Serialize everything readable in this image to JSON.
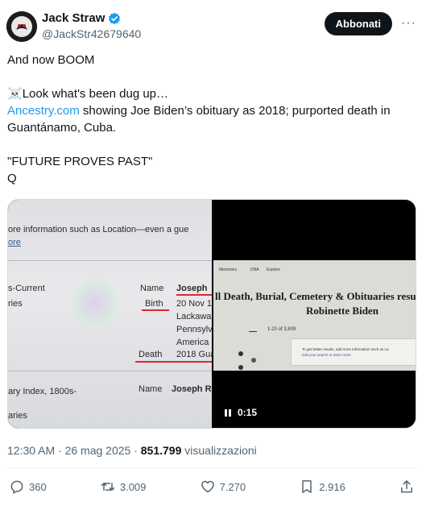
{
  "author": {
    "name": "Jack Straw",
    "handle": "@JackStr42679640",
    "verified": true
  },
  "subscribe_label": "Abbonati",
  "more_label": "···",
  "tweet": {
    "line1": "And now BOOM",
    "line2_emoji": "☠️",
    "line2": "Look what's been dug up…",
    "link": "Ancestry.com",
    "line3_rest": " showing Joe Biden’s obituary as 2018; purported death in Guantánamo, Cuba.",
    "line4": "\"FUTURE PROVES PAST\"",
    "line5": "Q"
  },
  "photo": {
    "line_top": "ore information such as Location—even a gue",
    "line_top_bold": "Location",
    "more_link": "ore",
    "col1_a": "s-Current",
    "col1_b": "ries",
    "name_label": "Name",
    "name_value": "Joseph",
    "birth_label": "Birth",
    "birth_value": "20 Nov 1",
    "birth_place1": "Lackawa",
    "birth_place2": "Pennsylv",
    "birth_place3": "America",
    "death_label": "Death",
    "death_value": "2018 Gua",
    "index_label": "ary Index, 1800s-",
    "index_b": "aries",
    "name2_label": "Name",
    "name2_value": "Joseph R"
  },
  "video": {
    "nav1": "Memories",
    "nav2": "DNA",
    "nav3": "Explore",
    "title1": "ll Death, Burial, Cemetery & Obituaries resu",
    "title2": "Robinette Biden",
    "count": "1-20 of 3,809",
    "note1": "To get better results, add more information such as La",
    "note2": "Edit your search or learn more",
    "duration": "0:15"
  },
  "meta": {
    "time": "12:30 AM · 26 mag 2025 · ",
    "views": "851.799",
    "views_label": " visualizzazioni"
  },
  "actions": {
    "replies": "360",
    "reposts": "3.009",
    "likes": "7.270",
    "bookmarks": "2.916"
  },
  "colors": {
    "accent": "#1d9bf0",
    "text": "#0f1419",
    "muted": "#536471",
    "annotation_red": "#e0262b"
  }
}
